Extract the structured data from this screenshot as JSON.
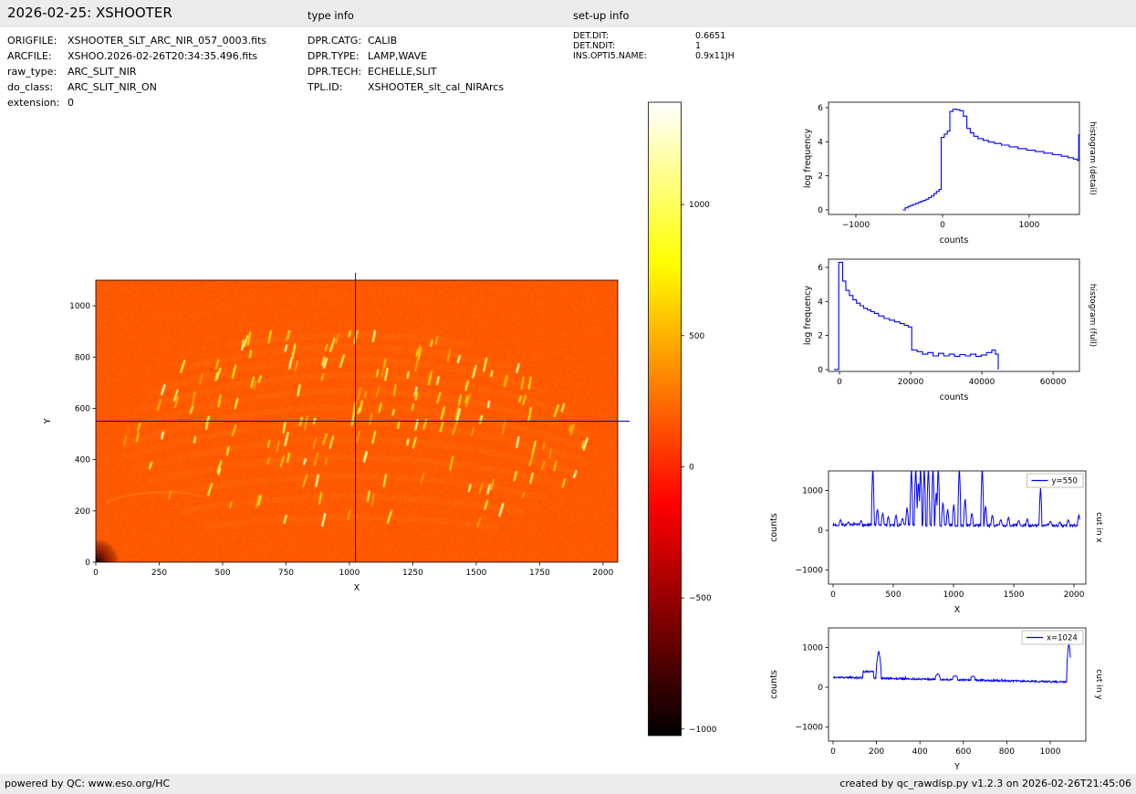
{
  "header": {
    "title": "2026-02-25: XSHOOTER",
    "type_info_label": "type info",
    "setup_info_label": "set-up info"
  },
  "file_info": {
    "rows": [
      {
        "label": "ORIGFILE:",
        "value": "XSHOOTER_SLT_ARC_NIR_057_0003.fits"
      },
      {
        "label": "ARCFILE:",
        "value": "XSHOO.2026-02-26T20:34:35.496.fits"
      },
      {
        "label": "raw_type:",
        "value": "ARC_SLIT_NIR"
      },
      {
        "label": "do_class:",
        "value": "ARC_SLIT_NIR_ON"
      },
      {
        "label": "extension:",
        "value": "0"
      }
    ]
  },
  "type_info": {
    "rows": [
      {
        "label": "DPR.CATG:",
        "value": "CALIB"
      },
      {
        "label": "DPR.TYPE:",
        "value": "LAMP,WAVE"
      },
      {
        "label": "DPR.TECH:",
        "value": "ECHELLE,SLIT"
      },
      {
        "label": "TPL.ID:",
        "value": "XSHOOTER_slt_cal_NIRArcs"
      }
    ]
  },
  "setup_info": {
    "rows": [
      {
        "label": "DET.DIT:",
        "value": "0.6651"
      },
      {
        "label": "DET.NDIT:",
        "value": "1"
      },
      {
        "label": "INS.OPTI5.NAME:",
        "value": "0.9x11JH"
      }
    ]
  },
  "footer": {
    "left": "powered by QC: www.eso.org/HC",
    "right": "created by qc_rawdisp.py v1.2.3 on 2026-02-26T21:45:06"
  },
  "chart_data": [
    {
      "id": "raw_image",
      "type": "heatmap",
      "xlabel": "X",
      "ylabel": "Y",
      "xlim": [
        0,
        2058
      ],
      "ylim": [
        0,
        1100
      ],
      "xticks": [
        0,
        250,
        500,
        750,
        1000,
        1250,
        1500,
        1750,
        2000
      ],
      "yticks": [
        0,
        200,
        400,
        600,
        800,
        1000
      ],
      "colormap": "hot",
      "vmin": -1025,
      "vmax": 1390,
      "background_counts": 180,
      "noise_counts": 40,
      "crosshair": {
        "x": 1024,
        "y": 550,
        "color": "#0000ff"
      },
      "arc_center_x": 1000,
      "arc_half_span": 950,
      "seed": 42,
      "arc_rows": [
        {
          "y": 885,
          "sag": 150,
          "n": 12,
          "x0": 520,
          "x1": 1480
        },
        {
          "y": 838,
          "sag": 170,
          "n": 15,
          "x0": 330,
          "x1": 1670
        },
        {
          "y": 788,
          "sag": 180,
          "n": 18,
          "x0": 220,
          "x1": 1780
        },
        {
          "y": 730,
          "sag": 180,
          "n": 20,
          "x0": 150,
          "x1": 1900
        },
        {
          "y": 668,
          "sag": 175,
          "n": 20,
          "x0": 110,
          "x1": 1950
        },
        {
          "y": 605,
          "sag": 165,
          "n": 19,
          "x0": 100,
          "x1": 1960
        },
        {
          "y": 545,
          "sag": 155,
          "n": 18,
          "x0": 100,
          "x1": 1960
        },
        {
          "y": 478,
          "sag": 145,
          "n": 16,
          "x0": 140,
          "x1": 1910
        },
        {
          "y": 408,
          "sag": 135,
          "n": 14,
          "x0": 200,
          "x1": 1850
        },
        {
          "y": 335,
          "sag": 125,
          "n": 11,
          "x0": 260,
          "x1": 1790
        },
        {
          "y": 255,
          "sag": 115,
          "n": 8,
          "x0": 330,
          "x1": 1700
        },
        {
          "y": 175,
          "sag": 105,
          "n": 5,
          "x0": 430,
          "x1": 1600
        }
      ]
    },
    {
      "id": "colorbar",
      "type": "colorbar",
      "vmin": -1025,
      "vmax": 1390,
      "ticks": [
        1000,
        500,
        0,
        -500,
        -1000
      ],
      "colormap_stops": [
        {
          "pos": 0,
          "color": "#000000"
        },
        {
          "pos": 0.365,
          "color": "#ff0000"
        },
        {
          "pos": 0.746,
          "color": "#ffff00"
        },
        {
          "pos": 1,
          "color": "#ffffff"
        }
      ]
    },
    {
      "id": "histogram_detail",
      "type": "step",
      "right_label": "histogram (detail)",
      "xlabel": "counts",
      "ylabel": "log frequency",
      "color": "#0000ff",
      "xlim": [
        -1316,
        1580
      ],
      "ylim": [
        -0.27,
        6.32
      ],
      "xticks": [
        -1000,
        0,
        1000
      ],
      "yticks": [
        0,
        2,
        4,
        6
      ],
      "points": [
        [
          -460,
          0
        ],
        [
          -430,
          0.12
        ],
        [
          -400,
          0.2
        ],
        [
          -370,
          0.26
        ],
        [
          -340,
          0.32
        ],
        [
          -310,
          0.38
        ],
        [
          -280,
          0.44
        ],
        [
          -250,
          0.5
        ],
        [
          -220,
          0.56
        ],
        [
          -190,
          0.63
        ],
        [
          -160,
          0.72
        ],
        [
          -130,
          0.82
        ],
        [
          -100,
          0.95
        ],
        [
          -70,
          1.08
        ],
        [
          -40,
          1.2
        ],
        [
          -15,
          4.25
        ],
        [
          20,
          4.45
        ],
        [
          55,
          4.62
        ],
        [
          85,
          5.78
        ],
        [
          120,
          5.92
        ],
        [
          160,
          5.88
        ],
        [
          200,
          5.82
        ],
        [
          240,
          5.5
        ],
        [
          280,
          4.78
        ],
        [
          320,
          4.52
        ],
        [
          360,
          4.32
        ],
        [
          410,
          4.18
        ],
        [
          470,
          4.08
        ],
        [
          530,
          3.98
        ],
        [
          600,
          3.9
        ],
        [
          680,
          3.8
        ],
        [
          770,
          3.7
        ],
        [
          870,
          3.6
        ],
        [
          970,
          3.5
        ],
        [
          1070,
          3.42
        ],
        [
          1170,
          3.33
        ],
        [
          1270,
          3.24
        ],
        [
          1370,
          3.15
        ],
        [
          1450,
          3.06
        ],
        [
          1510,
          2.98
        ],
        [
          1555,
          2.9
        ],
        [
          1572,
          4.42
        ],
        [
          1580,
          4.42
        ]
      ]
    },
    {
      "id": "histogram_full",
      "type": "step",
      "right_label": "histogram (full)",
      "xlabel": "counts",
      "ylabel": "log frequency",
      "color": "#0000ff",
      "xlim": [
        -3080,
        67400
      ],
      "ylim": [
        -0.11,
        6.48
      ],
      "xticks": [
        0,
        20000,
        40000,
        60000
      ],
      "yticks": [
        0,
        2,
        4,
        6
      ],
      "points": [
        [
          -1500,
          0
        ],
        [
          -200,
          6.3
        ],
        [
          900,
          5.2
        ],
        [
          1800,
          4.65
        ],
        [
          2800,
          4.35
        ],
        [
          3800,
          4.1
        ],
        [
          4800,
          3.9
        ],
        [
          5800,
          3.75
        ],
        [
          6800,
          3.6
        ],
        [
          7800,
          3.5
        ],
        [
          8800,
          3.4
        ],
        [
          9800,
          3.3
        ],
        [
          11000,
          3.15
        ],
        [
          12500,
          3.0
        ],
        [
          14000,
          2.9
        ],
        [
          15500,
          2.8
        ],
        [
          17000,
          2.7
        ],
        [
          18200,
          2.6
        ],
        [
          19300,
          2.5
        ],
        [
          20300,
          1.15
        ],
        [
          21800,
          1.05
        ],
        [
          23300,
          0.9
        ],
        [
          24800,
          1.0
        ],
        [
          26300,
          0.8
        ],
        [
          27800,
          0.95
        ],
        [
          29300,
          0.8
        ],
        [
          30800,
          0.9
        ],
        [
          32300,
          0.78
        ],
        [
          33800,
          0.88
        ],
        [
          35300,
          0.8
        ],
        [
          36800,
          0.9
        ],
        [
          38300,
          0.78
        ],
        [
          39800,
          0.85
        ],
        [
          41300,
          1.0
        ],
        [
          42800,
          1.15
        ],
        [
          43800,
          0.9
        ],
        [
          44600,
          0
        ]
      ]
    },
    {
      "id": "cut_x",
      "type": "cut",
      "legend": "y=550",
      "right_label": "cut in x",
      "xlabel": "X",
      "ylabel": "counts",
      "color": "#0000ff",
      "xlim": [
        -38,
        2098
      ],
      "ylim": [
        -1350,
        1490
      ],
      "xticks": [
        0,
        500,
        1000,
        1500,
        2000
      ],
      "yticks": [
        -1000,
        0,
        1000
      ],
      "data_x0": 0,
      "data_x1": 2048,
      "baseline_start": 135,
      "baseline_end": 115,
      "noise": 33,
      "seed": 7,
      "plateaus": [],
      "spikes": [
        [
          62,
          270
        ],
        [
          128,
          210
        ],
        [
          232,
          250
        ],
        [
          330,
          1600
        ],
        [
          368,
          540
        ],
        [
          412,
          440
        ],
        [
          458,
          350
        ],
        [
          522,
          390
        ],
        [
          576,
          310
        ],
        [
          614,
          580
        ],
        [
          650,
          1600
        ],
        [
          686,
          1600
        ],
        [
          708,
          1250
        ],
        [
          726,
          1600
        ],
        [
          757,
          1600
        ],
        [
          791,
          1600
        ],
        [
          829,
          1600
        ],
        [
          856,
          950
        ],
        [
          873,
          1600
        ],
        [
          912,
          720
        ],
        [
          951,
          530
        ],
        [
          1002,
          650
        ],
        [
          1048,
          1600
        ],
        [
          1096,
          820
        ],
        [
          1152,
          430
        ],
        [
          1238,
          1600
        ],
        [
          1266,
          620
        ],
        [
          1322,
          390
        ],
        [
          1392,
          270
        ],
        [
          1456,
          330
        ],
        [
          1541,
          250
        ],
        [
          1612,
          290
        ],
        [
          1722,
          1080
        ],
        [
          1804,
          230
        ],
        [
          1882,
          210
        ],
        [
          1952,
          270
        ],
        [
          2040,
          390
        ]
      ]
    },
    {
      "id": "cut_y",
      "type": "cut",
      "legend": "x=1024",
      "right_label": "cut in y",
      "xlabel": "Y",
      "ylabel": "counts",
      "color": "#0000ff",
      "xlim": [
        -21,
        1164
      ],
      "ylim": [
        -1350,
        1490
      ],
      "xticks": [
        0,
        200,
        400,
        600,
        800,
        1000
      ],
      "yticks": [
        -1000,
        0,
        1000
      ],
      "data_x0": 0,
      "data_x1": 1093,
      "baseline_start": 250,
      "baseline_end": 130,
      "noise": 22,
      "seed": 11,
      "plateaus": [
        {
          "x0": 138,
          "x1": 186,
          "v": 395
        }
      ],
      "spikes": [
        [
          210,
          920,
          12
        ],
        [
          482,
          340,
          10
        ],
        [
          562,
          290,
          10
        ],
        [
          644,
          280,
          9
        ],
        [
          1086,
          1150,
          10
        ]
      ]
    }
  ]
}
